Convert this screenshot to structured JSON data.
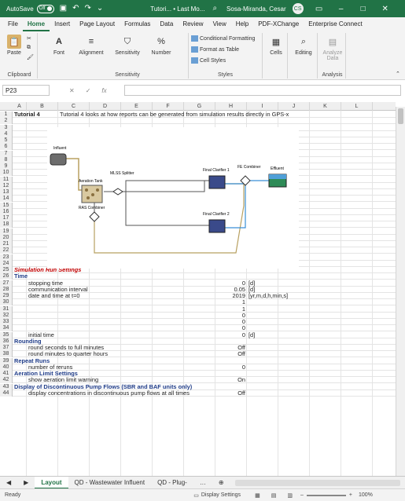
{
  "titlebar": {
    "autosave": "AutoSave",
    "toggle": "Off",
    "doc_title": "Tutori... • Last Mo...",
    "user": "Sosa-Miranda, Cesar",
    "avatar": "CS"
  },
  "menu": [
    "File",
    "Home",
    "Insert",
    "Page Layout",
    "Formulas",
    "Data",
    "Review",
    "View",
    "Help",
    "PDF-XChange",
    "Enterprise Connect"
  ],
  "ribbon": {
    "paste": "Paste",
    "clipboard": "Clipboard",
    "font": "Font",
    "alignment": "Alignment",
    "sensitivity": "Sensitivity",
    "number": "Number",
    "sensitivity_group": "Sensitivity",
    "cond": "Conditional Formatting",
    "fmt_table": "Format as Table",
    "cell_styles": "Cell Styles",
    "styles": "Styles",
    "cells": "Cells",
    "editing": "Editing",
    "analyze": "Analyze Data",
    "analysis": "Analysis"
  },
  "namebox": "P23",
  "columns": [
    "A",
    "B",
    "C",
    "D",
    "E",
    "F",
    "G",
    "H",
    "I",
    "J",
    "K",
    "L"
  ],
  "rows": [
    {
      "n": "1",
      "a": "Tutorial 4",
      "b": "",
      "c": "Tutorial 4 looks at how reports can be generated from simulation results directly in GPS-x",
      "h": "",
      "i": ""
    },
    {
      "n": "2"
    },
    {
      "n": "3"
    },
    {
      "n": "4"
    },
    {
      "n": "5"
    },
    {
      "n": "6"
    },
    {
      "n": "7"
    },
    {
      "n": "8"
    },
    {
      "n": "9"
    },
    {
      "n": "10"
    },
    {
      "n": "11"
    },
    {
      "n": "12"
    },
    {
      "n": "13"
    },
    {
      "n": "14"
    },
    {
      "n": "15"
    },
    {
      "n": "16"
    },
    {
      "n": "17"
    },
    {
      "n": "18"
    },
    {
      "n": "19"
    },
    {
      "n": "20"
    },
    {
      "n": "21"
    },
    {
      "n": "22"
    },
    {
      "n": "23"
    },
    {
      "n": "24"
    },
    {
      "n": "25",
      "a": "Simulation Run Settings",
      "style": "red"
    },
    {
      "n": "26",
      "a": "Time",
      "style": "blue"
    },
    {
      "n": "27",
      "b": "stopping time",
      "h": "0",
      "i": "[d]"
    },
    {
      "n": "28",
      "b": "communication interval",
      "h": "0.05",
      "i": "[d]"
    },
    {
      "n": "29",
      "b": "date and time at t=0",
      "h": "2019",
      "i": "[yr,m,d,h,min,s]"
    },
    {
      "n": "30",
      "h": "1"
    },
    {
      "n": "31",
      "h": "1"
    },
    {
      "n": "32",
      "h": "0"
    },
    {
      "n": "33",
      "h": "0"
    },
    {
      "n": "34",
      "h": "0"
    },
    {
      "n": "35",
      "b": "initial time",
      "h": "0",
      "i": "[d]"
    },
    {
      "n": "36",
      "a": "Rounding",
      "style": "blue"
    },
    {
      "n": "37",
      "b": "round seconds to full minutes",
      "h": "Off"
    },
    {
      "n": "38",
      "b": "round minutes to quarter hours",
      "h": "Off"
    },
    {
      "n": "39",
      "a": "Repeat Runs",
      "style": "blue"
    },
    {
      "n": "40",
      "b": "number of reruns",
      "h": "0"
    },
    {
      "n": "41",
      "a": "Aeration Limit Settings",
      "style": "blue"
    },
    {
      "n": "42",
      "b": "show aeration limit warning",
      "h": "On"
    },
    {
      "n": "43",
      "a": "Display of Discontinuous Pump Flows (SBR and BAF units only)",
      "style": "blue"
    },
    {
      "n": "44",
      "b": "display concentrations in discontinuous pump flows at all times",
      "h": "Off"
    }
  ],
  "diagram": {
    "influent": "Influent",
    "aeration": "Aeration Tank",
    "splitter": "MLSS Splitter",
    "clar1": "Final Clarifier 1",
    "fe": "FE Combiner",
    "effluent": "Effluent",
    "ras": "RAS Combiner",
    "clar2": "Final Clarifier 2"
  },
  "sheets": [
    "Layout",
    "QD - Wastewater Influent",
    "QD - Plug-"
  ],
  "status": {
    "ready": "Ready",
    "display": "Display Settings",
    "zoom": "100%"
  }
}
